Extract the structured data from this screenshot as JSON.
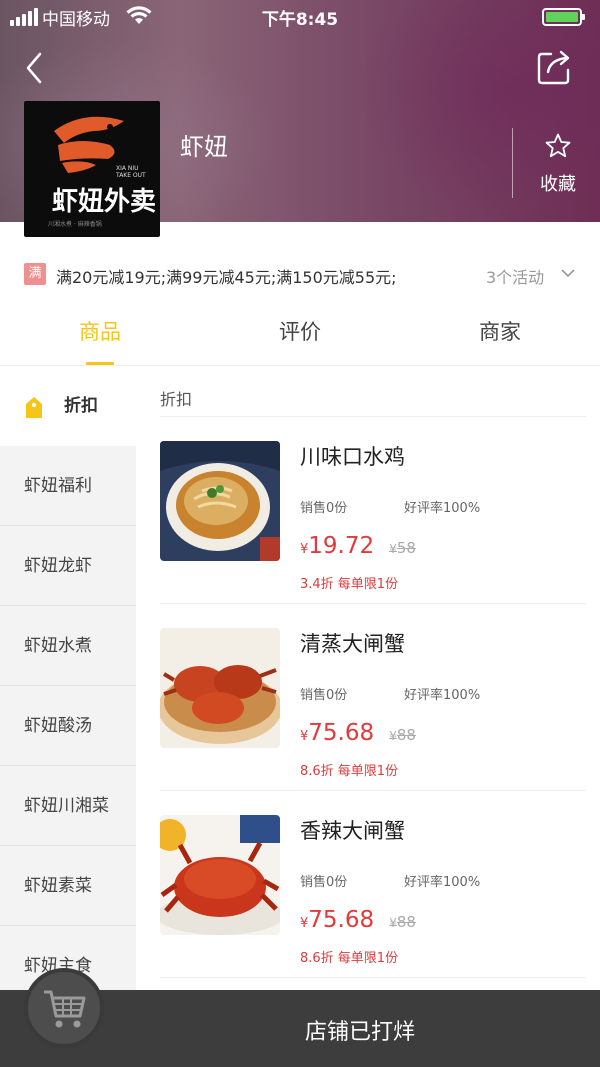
{
  "status_bar": {
    "carrier": "中国移动",
    "time": "下午8:45"
  },
  "shop": {
    "name": "虾妞",
    "logo_text_cn": "虾妞外卖",
    "logo_text_en": "XIA NIU\nTAKE OUT",
    "logo_subtitle": "川湘水煮 · 麻辣香锅",
    "favorite_label": "收藏"
  },
  "promo": {
    "badge": "满",
    "text": "满20元减19元;满99元减45元;满150元减55元;",
    "activity_count": "3个活动"
  },
  "tabs": [
    {
      "label": "商品",
      "active": true
    },
    {
      "label": "评价",
      "active": false
    },
    {
      "label": "商家",
      "active": false
    }
  ],
  "sidebar": {
    "items": [
      {
        "label": "折扣",
        "active": true
      },
      {
        "label": "虾妞福利"
      },
      {
        "label": "虾妞龙虾"
      },
      {
        "label": "虾妞水煮"
      },
      {
        "label": "虾妞酸汤"
      },
      {
        "label": "虾妞川湘菜"
      },
      {
        "label": "虾妞素菜"
      },
      {
        "label": "虾妞主食"
      }
    ]
  },
  "section": {
    "title": "折扣"
  },
  "products": [
    {
      "name": "川味口水鸡",
      "sales": "销售0份",
      "rating": "好评率100%",
      "currency": "¥",
      "price": "19.72",
      "original_price": "58",
      "discount": "3.4折 每单限1份"
    },
    {
      "name": "清蒸大闸蟹",
      "sales": "销售0份",
      "rating": "好评率100%",
      "currency": "¥",
      "price": "75.68",
      "original_price": "88",
      "discount": "8.6折 每单限1份"
    },
    {
      "name": "香辣大闸蟹",
      "sales": "销售0份",
      "rating": "好评率100%",
      "currency": "¥",
      "price": "75.68",
      "original_price": "88",
      "discount": "8.6折 每单限1份"
    }
  ],
  "bottom_bar": {
    "status": "店铺已打烊"
  },
  "colors": {
    "accent": "#f5c518",
    "price": "#e2393b",
    "bottom_bar": "#3d3d3d"
  },
  "icons": [
    "signal-icon",
    "wifi-icon",
    "battery-icon",
    "back-icon",
    "share-icon",
    "star-icon",
    "chevron-down-icon",
    "tag-icon",
    "cart-icon"
  ]
}
